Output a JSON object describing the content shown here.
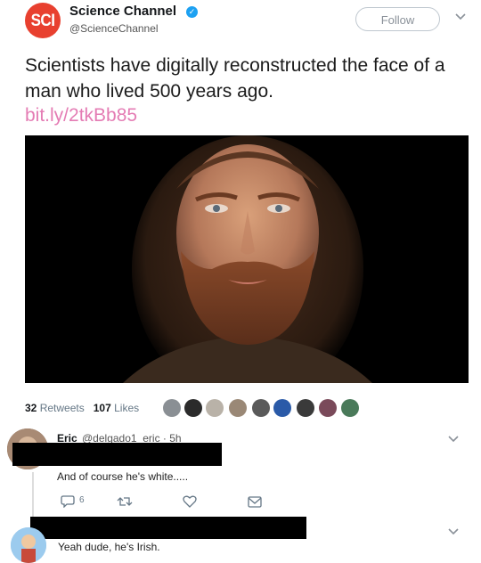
{
  "account": {
    "logo_text": "SCI",
    "name": "Science Channel",
    "handle": "@ScienceChannel",
    "follow_label": "Follow"
  },
  "tweet": {
    "text": "Scientists have digitally reconstructed the face of a man who lived 500 years ago.",
    "link": "bit.ly/2tkBb85",
    "image": "digitally reconstructed face of a bearded man with long brown hair"
  },
  "stats": {
    "retweets_count": "32",
    "retweets_label": "Retweets",
    "likes_count": "107",
    "likes_label": "Likes"
  },
  "replies": [
    {
      "name": "Eric",
      "handle": "@delgado1_eric",
      "time": "5h",
      "text": "And of course he's white.....",
      "reply_count": "6"
    },
    {
      "text": "Yeah dude, he's Irish."
    }
  ],
  "colors": {
    "brand_red": "#e8402f",
    "link_pink": "#e47cb4",
    "verified_blue": "#1da1f2"
  }
}
